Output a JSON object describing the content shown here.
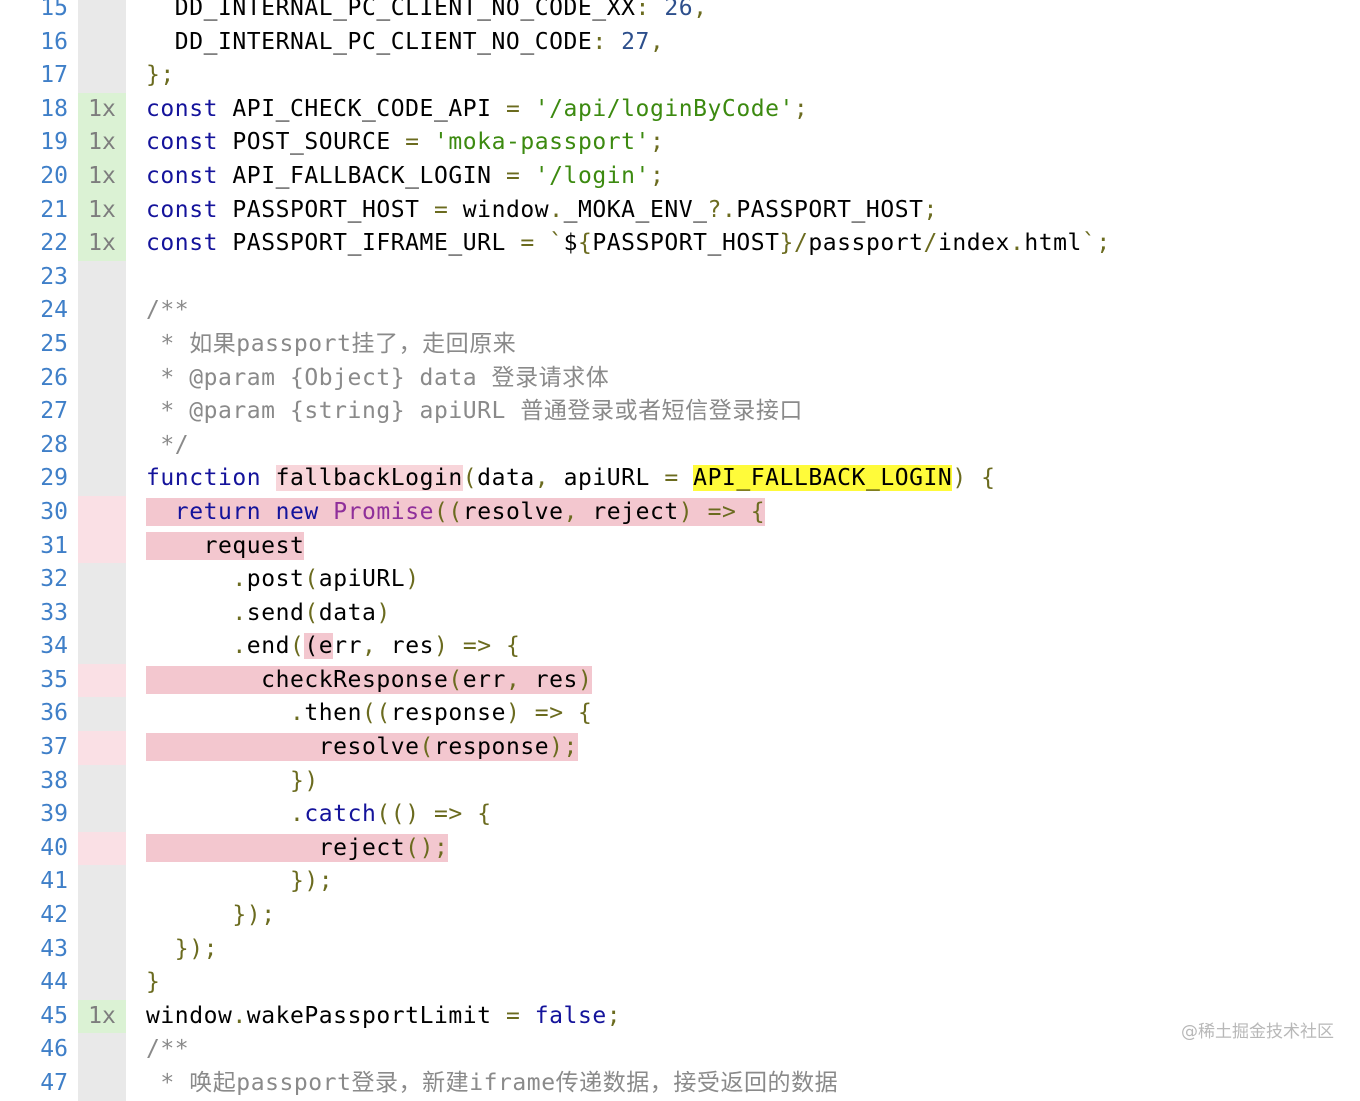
{
  "watermark": "@稀土掘金技术社区",
  "lines": [
    {
      "n": "15",
      "cov": "",
      "covType": "none",
      "text": "  DD_INTERNAL_PC_CLIENT_NO_CODE_XX: 26,"
    },
    {
      "n": "16",
      "cov": "",
      "covType": "none",
      "text": "  DD_INTERNAL_PC_CLIENT_NO_CODE: 27,"
    },
    {
      "n": "17",
      "cov": "",
      "covType": "none",
      "text": "};"
    },
    {
      "n": "18",
      "cov": "1x",
      "covType": "hit",
      "text": "const API_CHECK_CODE_API = '/api/loginByCode';"
    },
    {
      "n": "19",
      "cov": "1x",
      "covType": "hit",
      "text": "const POST_SOURCE = 'moka-passport';"
    },
    {
      "n": "20",
      "cov": "1x",
      "covType": "hit",
      "text": "const API_FALLBACK_LOGIN = '/login';"
    },
    {
      "n": "21",
      "cov": "1x",
      "covType": "hit",
      "text": "const PASSPORT_HOST = window._MOKA_ENV_?.PASSPORT_HOST;"
    },
    {
      "n": "22",
      "cov": "1x",
      "covType": "hit",
      "text": "const PASSPORT_IFRAME_URL = `${PASSPORT_HOST}/passport/index.html`;"
    },
    {
      "n": "23",
      "cov": "",
      "covType": "none",
      "text": ""
    },
    {
      "n": "24",
      "cov": "",
      "covType": "none",
      "text": "/**"
    },
    {
      "n": "25",
      "cov": "",
      "covType": "none",
      "text": " * 如果passport挂了，走回原来"
    },
    {
      "n": "26",
      "cov": "",
      "covType": "none",
      "text": " * @param {Object} data 登录请求体"
    },
    {
      "n": "27",
      "cov": "",
      "covType": "none",
      "text": " * @param {string} apiURL 普通登录或者短信登录接口"
    },
    {
      "n": "28",
      "cov": "",
      "covType": "none",
      "text": " */"
    },
    {
      "n": "29",
      "cov": "",
      "covType": "none",
      "text": "function fallbackLogin(data, apiURL = API_FALLBACK_LOGIN) {"
    },
    {
      "n": "30",
      "cov": "",
      "covType": "miss",
      "text": "  return new Promise((resolve, reject) => {"
    },
    {
      "n": "31",
      "cov": "",
      "covType": "miss",
      "text": "    request"
    },
    {
      "n": "32",
      "cov": "",
      "covType": "none",
      "text": "      .post(apiURL)"
    },
    {
      "n": "33",
      "cov": "",
      "covType": "none",
      "text": "      .send(data)"
    },
    {
      "n": "34",
      "cov": "",
      "covType": "none",
      "text": "      .end((err, res) => {"
    },
    {
      "n": "35",
      "cov": "",
      "covType": "miss",
      "text": "        checkResponse(err, res)"
    },
    {
      "n": "36",
      "cov": "",
      "covType": "none",
      "text": "          .then((response) => {"
    },
    {
      "n": "37",
      "cov": "",
      "covType": "miss",
      "text": "            resolve(response);"
    },
    {
      "n": "38",
      "cov": "",
      "covType": "none",
      "text": "          })"
    },
    {
      "n": "39",
      "cov": "",
      "covType": "none",
      "text": "          .catch(() => {"
    },
    {
      "n": "40",
      "cov": "",
      "covType": "miss",
      "text": "            reject();"
    },
    {
      "n": "41",
      "cov": "",
      "covType": "none",
      "text": "          });"
    },
    {
      "n": "42",
      "cov": "",
      "covType": "none",
      "text": "      });"
    },
    {
      "n": "43",
      "cov": "",
      "covType": "none",
      "text": "  });"
    },
    {
      "n": "44",
      "cov": "",
      "covType": "none",
      "text": "}"
    },
    {
      "n": "45",
      "cov": "1x",
      "covType": "hit",
      "text": "window.wakePassportLimit = false;"
    },
    {
      "n": "46",
      "cov": "",
      "covType": "none",
      "text": "/**"
    },
    {
      "n": "47",
      "cov": "",
      "covType": "none",
      "text": " * 唤起passport登录，新建iframe传递数据，接受返回的数据"
    }
  ]
}
